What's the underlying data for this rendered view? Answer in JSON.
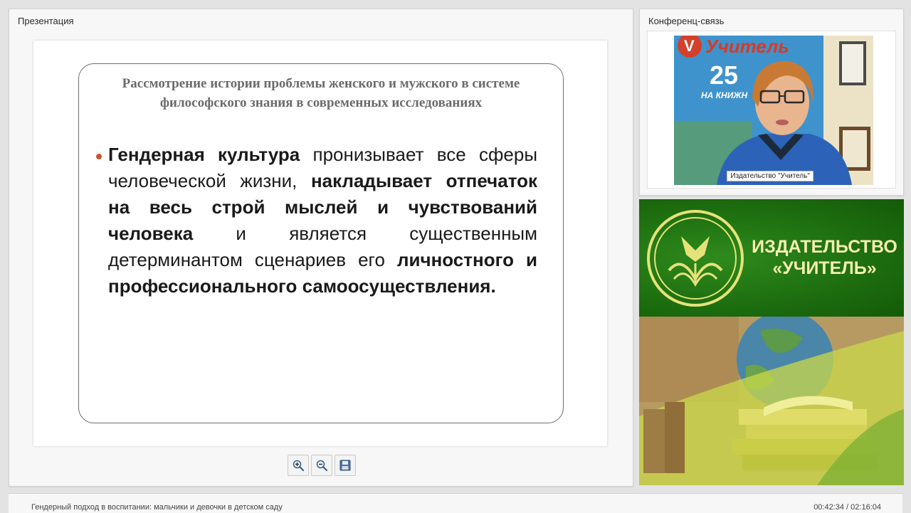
{
  "presentation": {
    "title": "Презентация",
    "slide": {
      "heading": "Рассмотрение истории проблемы женского и мужского в системе философского знания в современных исследованиях",
      "body": [
        {
          "text": "Гендерная культура",
          "bold": true
        },
        {
          "text": " пронизывает все сферы человеческой жизни, ",
          "bold": false
        },
        {
          "text": "накладывает отпечаток на весь строй мыслей и чувствований человека",
          "bold": true
        },
        {
          "text": " и является существенным детерминантом сценариев его ",
          "bold": false
        },
        {
          "text": "личностного и профессионального самоосуществления.",
          "bold": true
        }
      ]
    },
    "toolbar": [
      {
        "name": "zoom-in-button",
        "icon": "zoom-in-icon"
      },
      {
        "name": "zoom-out-button",
        "icon": "zoom-out-icon"
      },
      {
        "name": "save-button",
        "icon": "save-icon"
      }
    ]
  },
  "conference": {
    "title": "Конференц-связь",
    "video_label": "Издательство \"Учитель\"",
    "backdrop_text": {
      "brand": "Учитель",
      "number": "25",
      "tagline": "НА КНИЖН"
    }
  },
  "banner": {
    "publisher_line1": "ИЗДАТЕЛЬСТВО",
    "publisher_line2": "«УЧИТЕЛЬ»",
    "colors": {
      "green": "#1e6f10",
      "text": "#f5f0b0"
    }
  },
  "footer": {
    "course_title": "Гендерный подход в воспитании: мальчики и девочки в детском саду",
    "time": "00:42:34 / 02:16:04"
  }
}
